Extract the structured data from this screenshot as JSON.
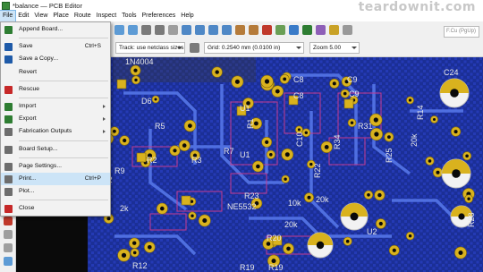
{
  "window": {
    "title": "*balance — PCB Editor",
    "watermark": "teardownit.com"
  },
  "menubar": {
    "items": [
      "File",
      "Edit",
      "View",
      "Place",
      "Route",
      "Inspect",
      "Tools",
      "Preferences",
      "Help"
    ]
  },
  "toolbar": {
    "track_width": "Track: use netclass sizes",
    "grid": "Grid: 0.2540 mm (0.0100 in)",
    "zoom": "Zoom 5.00",
    "search_value": "F.Cu (PgUp)"
  },
  "file_menu": {
    "items": [
      {
        "label": "Append Board...",
        "shortcut": "",
        "submenu": false,
        "icon": "append-board-icon",
        "icon_color": "#2e7d32"
      },
      {
        "separator": true
      },
      {
        "label": "Save",
        "shortcut": "Ctrl+S",
        "submenu": false,
        "icon": "save-icon",
        "icon_color": "#1e5aa8"
      },
      {
        "label": "Save a Copy...",
        "shortcut": "",
        "submenu": false,
        "icon": "save-copy-icon",
        "icon_color": "#1e5aa8"
      },
      {
        "label": "Revert",
        "shortcut": "",
        "submenu": false,
        "icon": "",
        "icon_color": ""
      },
      {
        "separator": true
      },
      {
        "label": "Rescue",
        "shortcut": "",
        "submenu": false,
        "icon": "rescue-icon",
        "icon_color": "#c62828"
      },
      {
        "separator": true
      },
      {
        "label": "Import",
        "shortcut": "",
        "submenu": true,
        "icon": "import-icon",
        "icon_color": "#2e7d32"
      },
      {
        "label": "Export",
        "shortcut": "",
        "submenu": true,
        "icon": "export-icon",
        "icon_color": "#2e7d32"
      },
      {
        "label": "Fabrication Outputs",
        "shortcut": "",
        "submenu": true,
        "icon": "fabrication-icon",
        "icon_color": "#6d6d6d"
      },
      {
        "separator": true
      },
      {
        "label": "Board Setup...",
        "shortcut": "",
        "submenu": false,
        "icon": "board-setup-icon",
        "icon_color": "#6d6d6d"
      },
      {
        "separator": true
      },
      {
        "label": "Page Settings...",
        "shortcut": "",
        "submenu": false,
        "icon": "page-settings-icon",
        "icon_color": "#6d6d6d"
      },
      {
        "label": "Print...",
        "shortcut": "Ctrl+P",
        "submenu": false,
        "icon": "print-icon",
        "icon_color": "#6d6d6d",
        "highlighted": true
      },
      {
        "label": "Plot...",
        "shortcut": "",
        "submenu": false,
        "icon": "plot-icon",
        "icon_color": "#6d6d6d"
      },
      {
        "separator": true
      },
      {
        "label": "Close",
        "shortcut": "",
        "submenu": false,
        "icon": "close-icon",
        "icon_color": "#c62828"
      }
    ]
  },
  "pcb_labels": [
    {
      "text": "1N4004",
      "rot": 0
    },
    {
      "text": "C24",
      "rot": 0
    },
    {
      "text": "C8",
      "rot": 0
    },
    {
      "text": "C9",
      "rot": 0
    },
    {
      "text": "C8",
      "rot": 0
    },
    {
      "text": "C9",
      "rot": 0
    },
    {
      "text": "D6",
      "rot": 0
    },
    {
      "text": "R5",
      "rot": 0
    },
    {
      "text": "U1",
      "rot": 0
    },
    {
      "text": "U1",
      "rot": 0
    },
    {
      "text": "R2",
      "rot": 0
    },
    {
      "text": "R3",
      "rot": 0
    },
    {
      "text": "R23",
      "rot": 0
    },
    {
      "text": "NE5532",
      "rot": 0
    },
    {
      "text": "20k",
      "rot": 0
    },
    {
      "text": "20k",
      "rot": 0
    },
    {
      "text": "R19",
      "rot": 0
    },
    {
      "text": "R19",
      "rot": 0
    },
    {
      "text": "R12",
      "rot": 0
    },
    {
      "text": "U2",
      "rot": 0
    },
    {
      "text": "C2",
      "rot": 0
    },
    {
      "text": "R7",
      "rot": 0
    },
    {
      "text": "R22",
      "rot": -90
    },
    {
      "text": "R31",
      "rot": 0
    },
    {
      "text": "R25",
      "rot": -90
    },
    {
      "text": "R28",
      "rot": -90
    },
    {
      "text": "2k",
      "rot": 0
    },
    {
      "text": "10k",
      "rot": 0
    },
    {
      "text": "20k",
      "rot": -90
    },
    {
      "text": "C10",
      "rot": -90
    },
    {
      "text": "R1",
      "rot": -90
    },
    {
      "text": "R20",
      "rot": 0
    },
    {
      "text": "R34",
      "rot": -90
    },
    {
      "text": "R14",
      "rot": -90
    },
    {
      "text": "R9",
      "rot": 0
    }
  ]
}
